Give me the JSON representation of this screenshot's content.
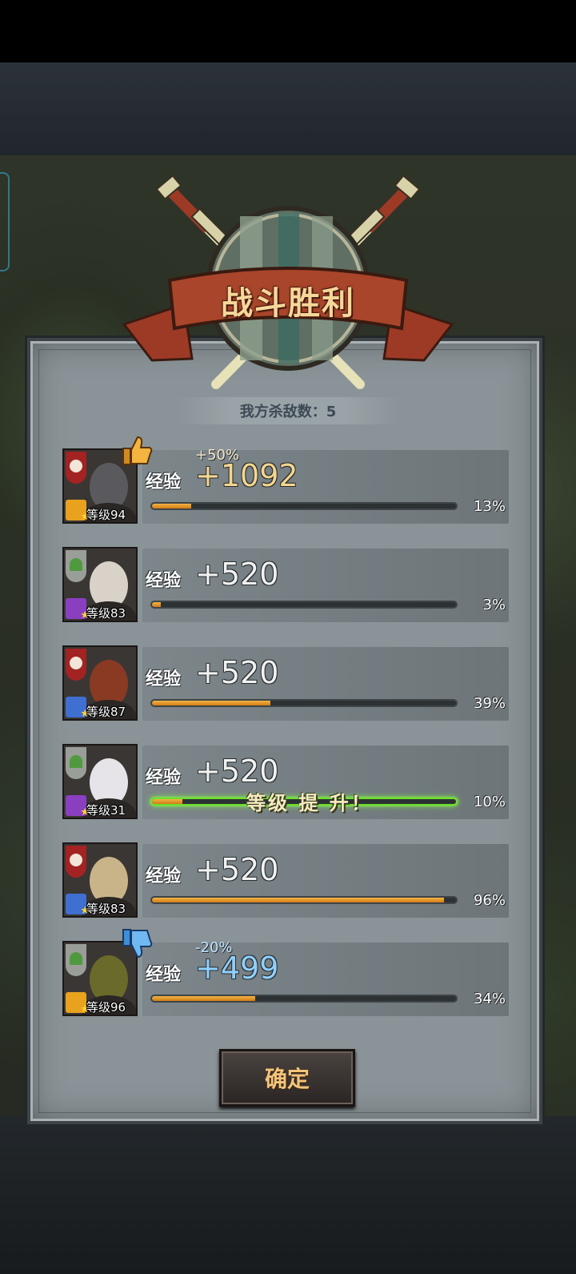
{
  "title": "战斗胜利",
  "kills_text": "我方杀敌数：5",
  "exp_label": "经验",
  "confirm_label": "确定",
  "level_up_text": "等级 提 升！",
  "heroes": [
    {
      "faction": "red",
      "class": "gold",
      "level": "等级94",
      "bonus": "+50%",
      "exp": "+1092",
      "exp_style": "gold",
      "progress": 13,
      "pct": "13%",
      "thumb": "up"
    },
    {
      "faction": "green",
      "class": "purple",
      "level": "等级83",
      "bonus": "",
      "exp": "+520",
      "exp_style": "normal",
      "progress": 3,
      "pct": "3%"
    },
    {
      "faction": "red",
      "class": "blue",
      "level": "等级87",
      "bonus": "",
      "exp": "+520",
      "exp_style": "normal",
      "progress": 39,
      "pct": "39%"
    },
    {
      "faction": "green",
      "class": "purple",
      "level": "等级31",
      "bonus": "",
      "exp": "+520",
      "exp_style": "normal",
      "progress": 10,
      "pct": "10%",
      "level_up": true
    },
    {
      "faction": "red",
      "class": "blue",
      "level": "等级83",
      "bonus": "",
      "exp": "+520",
      "exp_style": "normal",
      "progress": 96,
      "pct": "96%"
    },
    {
      "faction": "green",
      "class": "gold",
      "level": "等级96",
      "bonus": "-20%",
      "exp": "+499",
      "exp_style": "blue",
      "progress": 34,
      "pct": "34%",
      "thumb": "down"
    }
  ],
  "colors": {
    "accent_gold": "#f3d68f",
    "exp_bar": "#e59a2a",
    "level_up_glow": "#79ff3a",
    "penalty_blue": "#8fd0ff"
  }
}
